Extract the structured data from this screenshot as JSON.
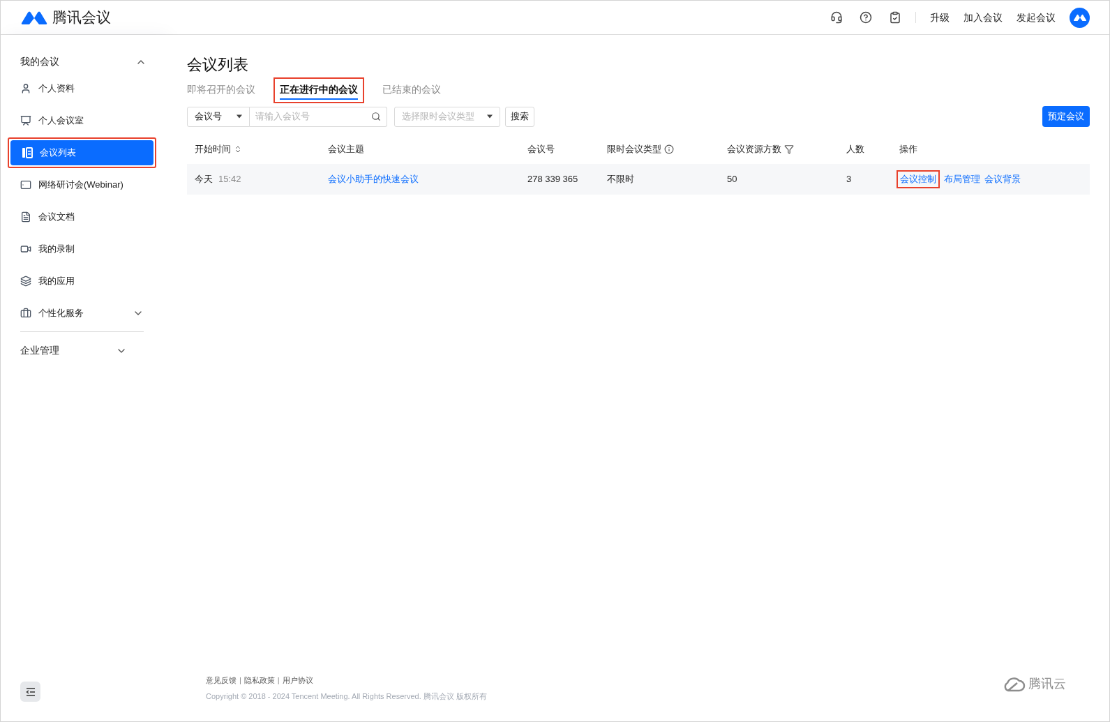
{
  "header": {
    "brand": "腾讯会议",
    "links": [
      "升级",
      "加入会议",
      "发起会议"
    ]
  },
  "sidebar": {
    "groups": [
      {
        "label": "我的会议",
        "expanded": true,
        "items": [
          {
            "label": "个人资料",
            "kind": "user",
            "selected": false,
            "highlighted": false
          },
          {
            "label": "个人会议室",
            "kind": "room",
            "selected": false,
            "highlighted": false
          },
          {
            "label": "会议列表",
            "kind": "list",
            "selected": true,
            "highlighted": true
          },
          {
            "label": "网络研讨会(Webinar)",
            "kind": "webinar",
            "selected": false,
            "highlighted": false
          },
          {
            "label": "会议文档",
            "kind": "doc",
            "selected": false,
            "highlighted": false
          },
          {
            "label": "我的录制",
            "kind": "video",
            "selected": false,
            "highlighted": false
          },
          {
            "label": "我的应用",
            "kind": "layers",
            "selected": false,
            "highlighted": false
          },
          {
            "label": "个性化服务",
            "kind": "bag",
            "selected": false,
            "highlighted": false,
            "expanded": false
          }
        ]
      },
      {
        "label": "企业管理",
        "expanded": false
      }
    ]
  },
  "page": {
    "title": "会议列表",
    "tabs": [
      {
        "label": "即将召开的会议",
        "selected": false,
        "highlighted": false
      },
      {
        "label": "正在进行中的会议",
        "selected": true,
        "highlighted": true
      },
      {
        "label": "已结束的会议",
        "selected": false,
        "highlighted": false
      }
    ],
    "filter": {
      "select": "会议号",
      "search_placeholder": "请输入会议号",
      "type_placeholder": "选择限时会议类型",
      "search_button": "搜索"
    },
    "book_button": "预定会议"
  },
  "table": {
    "columns": [
      {
        "label": "开始时间",
        "kind": "sort"
      },
      {
        "label": "会议主题",
        "kind": "plain"
      },
      {
        "label": "会议号",
        "kind": "plain"
      },
      {
        "label": "限时会议类型",
        "kind": "info"
      },
      {
        "label": "会议资源方数",
        "kind": "filter"
      },
      {
        "label": "人数",
        "kind": "plain"
      },
      {
        "label": "操作",
        "kind": "plain"
      }
    ],
    "rows": [
      {
        "day": "今天",
        "time": "15:42",
        "topic": "会议小助手的快速会议",
        "id": "278 339 365",
        "type": "不限时",
        "resources": "50",
        "count": "3",
        "actions": [
          {
            "label": "会议控制",
            "highlighted": true
          },
          {
            "label": "布局管理",
            "highlighted": false
          },
          {
            "label": "会议背景",
            "highlighted": false
          }
        ]
      }
    ]
  },
  "footer": {
    "links": [
      {
        "kind": "link",
        "text": "意见反馈"
      },
      {
        "kind": "separator",
        "text": "|"
      },
      {
        "kind": "link",
        "text": "隐私政策"
      },
      {
        "kind": "separator",
        "text": "|"
      },
      {
        "kind": "link",
        "text": "用户协议"
      }
    ],
    "copyright": "Copyright © 2018 - 2024 Tencent Meeting. All Rights Reserved. 腾讯会议 版权所有",
    "cloud_brand": "腾讯云"
  }
}
